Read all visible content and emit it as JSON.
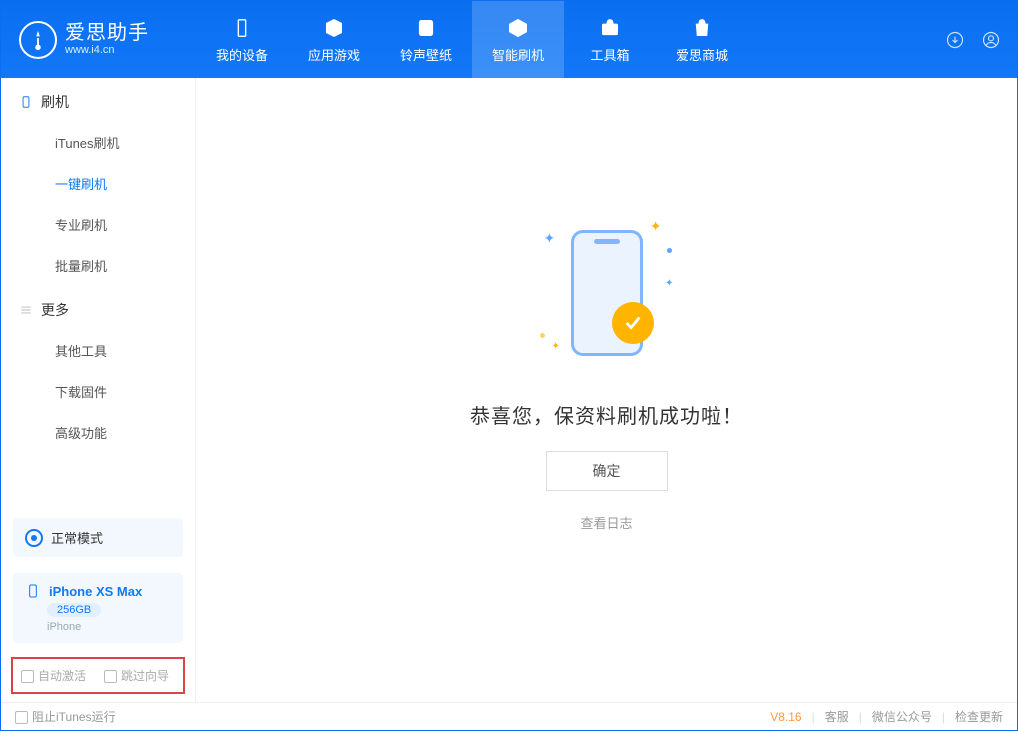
{
  "app": {
    "title": "爱思助手",
    "subtitle": "www.i4.cn"
  },
  "nav": {
    "device": "我的设备",
    "apps": "应用游戏",
    "ringtone": "铃声壁纸",
    "flash": "智能刷机",
    "toolbox": "工具箱",
    "store": "爱思商城"
  },
  "sidebar": {
    "section_flash": "刷机",
    "items_flash": {
      "itunes": "iTunes刷机",
      "oneclick": "一键刷机",
      "pro": "专业刷机",
      "batch": "批量刷机"
    },
    "section_more": "更多",
    "items_more": {
      "othertools": "其他工具",
      "firmware": "下载固件",
      "advanced": "高级功能"
    }
  },
  "mode": {
    "label": "正常模式"
  },
  "device": {
    "name": "iPhone XS Max",
    "capacity": "256GB",
    "type": "iPhone"
  },
  "options": {
    "auto_activate": "自动激活",
    "skip_guide": "跳过向导"
  },
  "main": {
    "success_msg": "恭喜您，保资料刷机成功啦！",
    "ok": "确定",
    "view_log": "查看日志"
  },
  "footer": {
    "block_itunes": "阻止iTunes运行",
    "version": "V8.16",
    "support": "客服",
    "wechat": "微信公众号",
    "update": "检查更新"
  }
}
